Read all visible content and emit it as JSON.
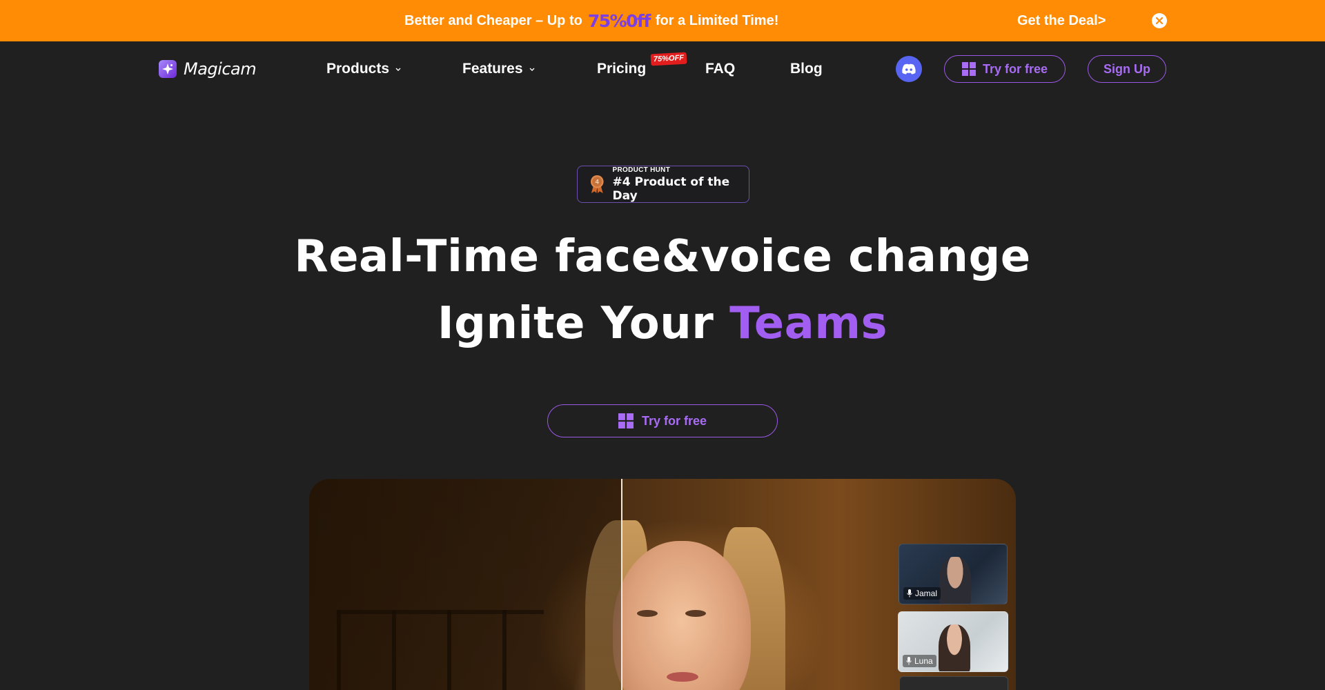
{
  "promo": {
    "text_before": "Better and Cheaper – Up to",
    "highlight": "75%0ff",
    "text_after": "for a Limited Time!",
    "deal_link": "Get the Deal>"
  },
  "nav": {
    "brand": "Magicam",
    "items": [
      {
        "label": "Products",
        "has_dropdown": true
      },
      {
        "label": "Features",
        "has_dropdown": true
      },
      {
        "label": "Pricing",
        "badge": "75%OFF"
      },
      {
        "label": "FAQ"
      },
      {
        "label": "Blog"
      }
    ],
    "try_label": "Try for free",
    "signup_label": "Sign Up"
  },
  "hero": {
    "badge_small": "PRODUCT HUNT",
    "badge_big": "#4 Product of the Day",
    "medal_number": "4",
    "headline_line1": "Real-Time face&voice change",
    "headline_line2_plain": "Ignite Your",
    "headline_line2_accent": "Teams",
    "cta_label": "Try for free"
  },
  "video": {
    "participants": [
      {
        "name": "Jamal"
      },
      {
        "name": "Luna"
      }
    ]
  },
  "colors": {
    "banner": "#ff8c04",
    "background": "#202020",
    "accent": "#a25ef0",
    "discord": "#5865f2",
    "badge_red": "#e11d1d"
  },
  "icons": [
    "logo-sparkle-icon",
    "chevron-down-icon",
    "discord-icon",
    "windows-icon",
    "close-icon",
    "medal-icon",
    "microphone-icon"
  ]
}
